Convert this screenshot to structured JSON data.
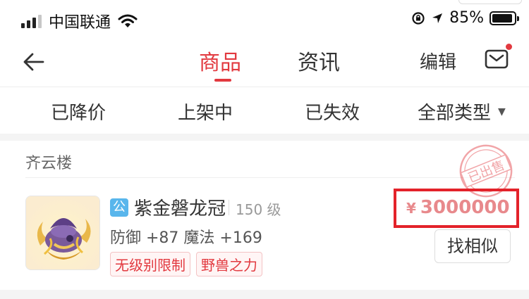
{
  "status_bar": {
    "carrier": "中国联通",
    "battery": "85%"
  },
  "nav": {
    "tabs": [
      {
        "label": "商品",
        "active": true
      },
      {
        "label": "资讯",
        "active": false
      }
    ],
    "edit_label": "编辑",
    "has_unread_message": true
  },
  "filters": [
    {
      "label": "已降价"
    },
    {
      "label": "上架中"
    },
    {
      "label": "已失效"
    },
    {
      "label": "全部类型",
      "dropdown": true
    }
  ],
  "listing": {
    "shop_name": "齐云楼",
    "stamp_text": "已出售",
    "item": {
      "badge": "公",
      "name": "紫金磐龙冠",
      "level": "150 级",
      "stats": "防御 +87  魔法 +169",
      "tags": [
        "无级别限制",
        "野兽之力"
      ],
      "currency": "¥",
      "price": "3000000",
      "similar_label": "找相似"
    }
  },
  "colors": {
    "accent": "#e2393f",
    "price": "#e8898c",
    "highlight_box": "#e3222a",
    "badge": "#59b6ec"
  }
}
